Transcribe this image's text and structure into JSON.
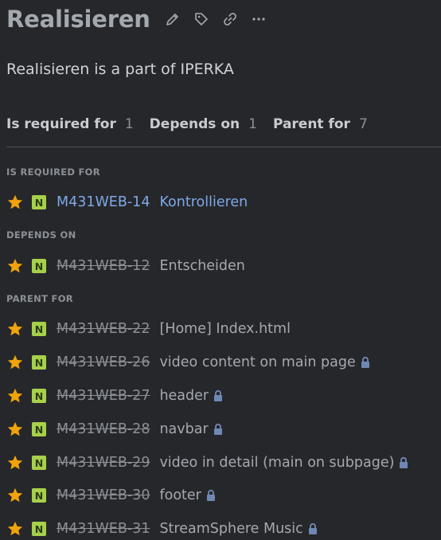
{
  "issue": {
    "title": "Realisieren",
    "description": "Realisieren is a part of IPERKA"
  },
  "icons": {
    "edit": "pencil-icon",
    "label": "tag-icon",
    "link": "link-icon",
    "more": "more-icon",
    "star": "star-icon",
    "lock": "lock-icon"
  },
  "colors": {
    "background": "#26272b",
    "link": "#7fa8e8",
    "star": "#f0a30a",
    "badge": "#a7d04a",
    "muted": "#8b9096"
  },
  "tabs": [
    {
      "label": "Is required for",
      "count": "1"
    },
    {
      "label": "Depends on",
      "count": "1"
    },
    {
      "label": "Parent for",
      "count": "7"
    }
  ],
  "sections": {
    "required_for": "IS REQUIRED FOR",
    "depends_on": "DEPENDS ON",
    "parent_for": "PARENT FOR"
  },
  "required_for": [
    {
      "badge": "N",
      "key": "M431WEB-14",
      "summary": "Kontrollieren"
    }
  ],
  "depends_on": [
    {
      "badge": "N",
      "key": "M431WEB-12",
      "summary": "Entscheiden"
    }
  ],
  "parent_for": [
    {
      "badge": "N",
      "key": "M431WEB-22",
      "summary": "[Home] Index.html"
    },
    {
      "badge": "N",
      "key": "M431WEB-26",
      "summary": "video content on main page"
    },
    {
      "badge": "N",
      "key": "M431WEB-27",
      "summary": "header"
    },
    {
      "badge": "N",
      "key": "M431WEB-28",
      "summary": "navbar"
    },
    {
      "badge": "N",
      "key": "M431WEB-29",
      "summary": "video in detail (main on subpage)"
    },
    {
      "badge": "N",
      "key": "M431WEB-30",
      "summary": "footer"
    },
    {
      "badge": "N",
      "key": "M431WEB-31",
      "summary": "StreamSphere Music"
    }
  ]
}
